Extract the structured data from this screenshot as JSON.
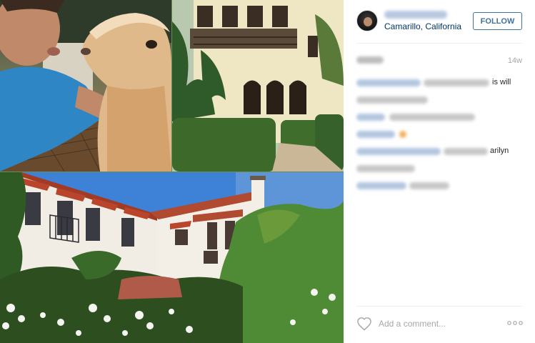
{
  "post": {
    "location": "Camarillo, California",
    "follow_label": "FOLLOW",
    "time_ago": "14w",
    "comment_fragments": {
      "line1_end": "is will",
      "line4_end": "arilyn"
    },
    "comment_placeholder": "Add a comment...",
    "more_glyph": "∘∘∘"
  },
  "colors": {
    "link": "#003569",
    "follow": "#3f729b",
    "muted": "#a5a7aa"
  },
  "icons": {
    "like": "heart-outline-icon",
    "more": "more-options-icon"
  }
}
